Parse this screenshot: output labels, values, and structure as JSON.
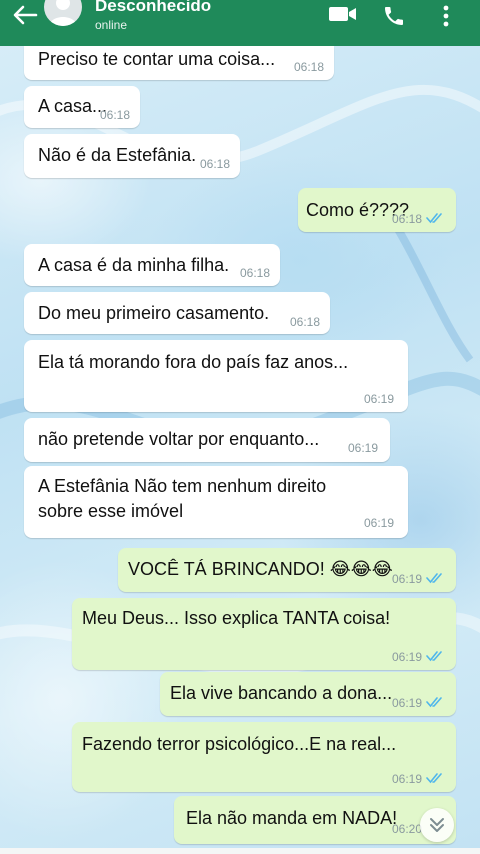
{
  "header": {
    "contact_name": "Desconhecido",
    "status": "online",
    "icons": [
      "back-arrow-icon",
      "video-call-icon",
      "phone-icon",
      "more-vertical-icon"
    ],
    "color": "#1f8a5a"
  },
  "colors": {
    "incoming_bubble": "#ffffff",
    "outgoing_bubble": "#e1f7cb",
    "read_ticks": "#4fb6ec"
  },
  "messages": [
    {
      "direction": "in",
      "text": "Preciso te contar uma coisa...",
      "time": "06:18"
    },
    {
      "direction": "in",
      "text": "A casa...",
      "time": "06:18"
    },
    {
      "direction": "in",
      "text": "Não é da Estefânia.",
      "time": "06:18"
    },
    {
      "direction": "out",
      "text": "Como é????",
      "time": "06:18",
      "read": true
    },
    {
      "direction": "in",
      "text": "A casa é da minha filha.",
      "time": "06:18"
    },
    {
      "direction": "in",
      "text": "Do meu primeiro casamento.",
      "time": "06:18"
    },
    {
      "direction": "in",
      "text": "Ela tá morando fora do país faz anos...",
      "time": "06:19"
    },
    {
      "direction": "in",
      "text": "não pretende voltar por enquanto...",
      "time": "06:19"
    },
    {
      "direction": "in",
      "text": "A Estefânia  Não tem nenhum direito sobre esse imóvel",
      "time": "06:19"
    },
    {
      "direction": "out",
      "text": "VOCÊ TÁ BRINCANDO! 😂😂😂",
      "time": "06:19",
      "read": true
    },
    {
      "direction": "out",
      "text": "Meu Deus... Isso explica TANTA coisa!",
      "time": "06:19",
      "read": true
    },
    {
      "direction": "out",
      "text": "Ela vive bancando a dona...",
      "time": "06:19",
      "read": true
    },
    {
      "direction": "out",
      "text": "Fazendo terror psicológico...E na real...",
      "time": "06:19",
      "read": true
    },
    {
      "direction": "out",
      "text": "Ela não manda em NADA!",
      "time": "06:20",
      "read": true
    }
  ]
}
